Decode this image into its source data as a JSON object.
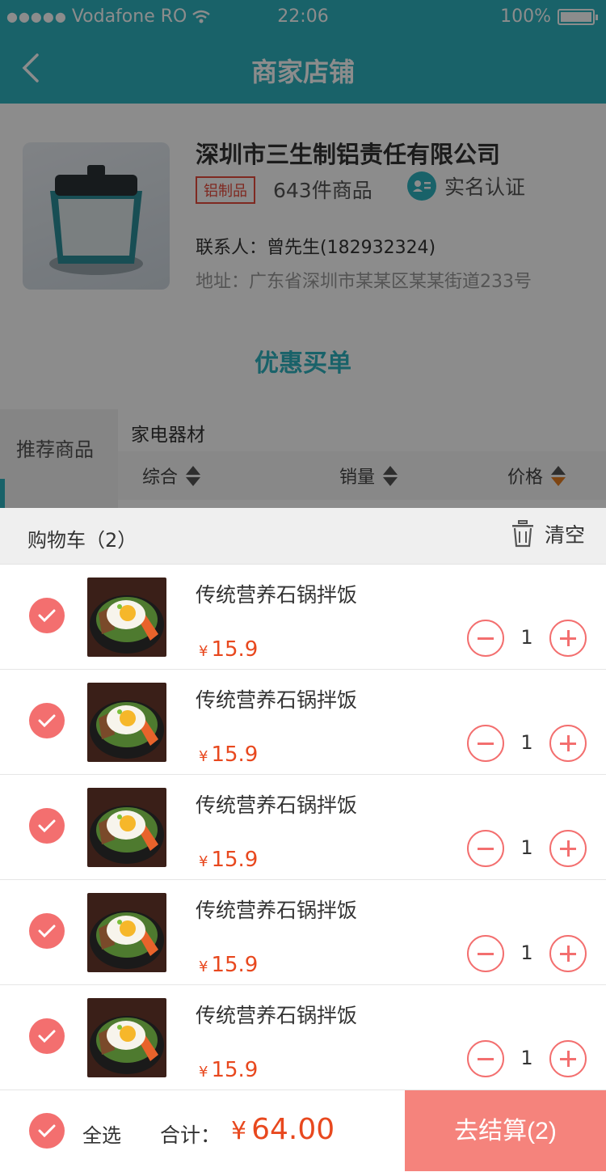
{
  "status_bar": {
    "carrier": "Vodafone RO",
    "time": "22:06",
    "battery": "100%",
    "battery_level": 1.0
  },
  "navbar": {
    "title": "商家店铺"
  },
  "store": {
    "name": "深圳市三生制铝责任有限公司",
    "tag": "铝制品",
    "product_count": "643件商品",
    "verification": "实名认证",
    "contact": "联系人：曾先生(182932324)",
    "address": "地址：广东省深圳市某某区某某街道233号"
  },
  "promo": {
    "label": "优惠买单"
  },
  "categories": {
    "sidebar_item": "推荐商品",
    "current": "家电器材",
    "sort_options": [
      "综合",
      "销量",
      "价格"
    ]
  },
  "cart": {
    "title": "购物车（2）",
    "clear_label": "清空",
    "items": [
      {
        "name": "传统营养石锅拌饭",
        "currency": "¥",
        "price": "15.9",
        "qty": "1"
      },
      {
        "name": "传统营养石锅拌饭",
        "currency": "¥",
        "price": "15.9",
        "qty": "1"
      },
      {
        "name": "传统营养石锅拌饭",
        "currency": "¥",
        "price": "15.9",
        "qty": "1"
      },
      {
        "name": "传统营养石锅拌饭",
        "currency": "¥",
        "price": "15.9",
        "qty": "1"
      },
      {
        "name": "传统营养石锅拌饭",
        "currency": "¥",
        "price": "15.9",
        "qty": "1"
      }
    ]
  },
  "footer": {
    "select_all": "全选",
    "total_label": "合计：",
    "total_currency": "¥",
    "total_value": "64.00",
    "checkout_label": "去结算(2)"
  },
  "colors": {
    "primary": "#2fb3c0",
    "accent_red": "#f36f6f",
    "price_red": "#e8481e",
    "checkout_bg": "#f5837c"
  },
  "icons": {
    "back": "chevron-left-icon",
    "wifi": "wifi-icon",
    "battery": "battery-icon",
    "verify": "id-card-icon",
    "trash": "trash-icon",
    "check": "check-icon",
    "minus": "minus-icon",
    "plus": "plus-icon"
  }
}
